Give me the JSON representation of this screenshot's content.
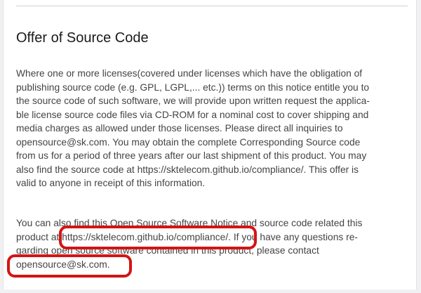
{
  "notice": {
    "title": "Offer of Source Code",
    "paragraph1": [
      "Where one or more licenses(covered under licenses which have the obligation of",
      "publishing source code (e.g. GPL, LGPL,... etc.)) terms on this notice entitle you to",
      "the source code of such software, we will provide upon written request the applica-",
      "ble license source code files via CD-ROM for a nominal cost to cover shipping and",
      "media charges as allowed under those licenses. Please direct all inquiries to",
      "opensource@sk.com. You may obtain the complete Corresponding Source code",
      "from us for a period of three years after our last shipment of this product. You may",
      "also find the source code at https://sktelecom.github.io/compliance/. This offer is",
      "valid to anyone in receipt of this information."
    ],
    "paragraph2": [
      "You can also find this Open Source Software Notice and source code related this",
      "product at https://sktelecom.github.io/compliance/. If you have any questions re-",
      "garding open source software contained in this product, please contact",
      "opensource@sk.com."
    ]
  },
  "colors": {
    "highlight": "#d41414",
    "background": "#f1f1f3",
    "panel": "#ffffff"
  }
}
